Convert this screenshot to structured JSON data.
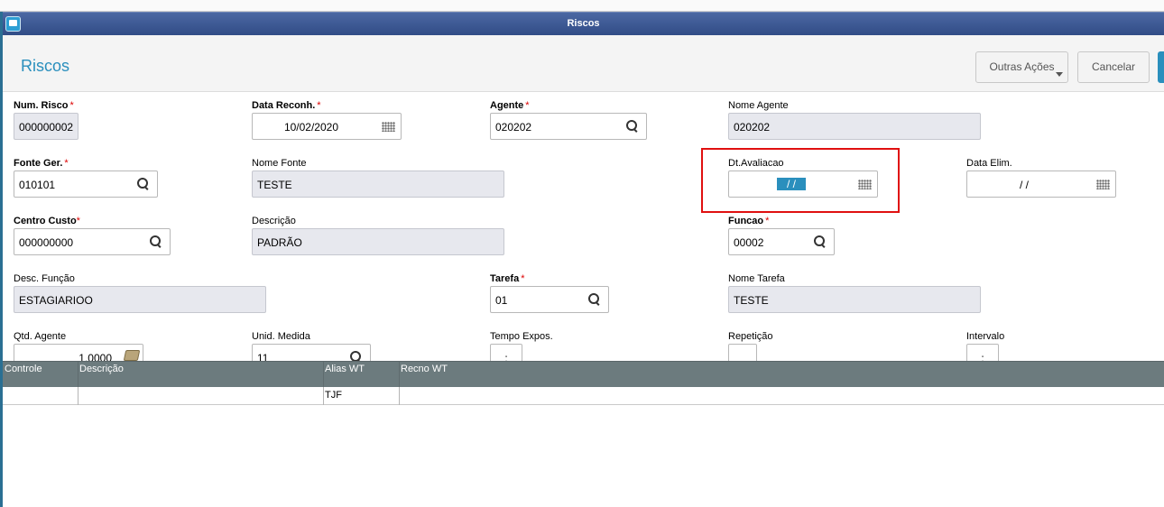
{
  "window": {
    "title": "Riscos"
  },
  "header": {
    "page_title": "Riscos",
    "buttons": {
      "other_actions": "Outras Ações",
      "cancel": "Cancelar"
    }
  },
  "fields": {
    "num_risco": {
      "label": "Num. Risco",
      "required": "*",
      "value": "000000002"
    },
    "data_reconh": {
      "label": "Data Reconh.",
      "required": "*",
      "value": "10/02/2020"
    },
    "agente": {
      "label": "Agente",
      "required": "*",
      "value": "020202"
    },
    "nome_agente": {
      "label": "Nome Agente",
      "value": "020202"
    },
    "fonte_ger": {
      "label": "Fonte Ger.",
      "required": "*",
      "value": "010101"
    },
    "nome_fonte": {
      "label": "Nome Fonte",
      "value": "TESTE"
    },
    "dt_avaliacao": {
      "label": "Dt.Avaliacao",
      "value": "/ /"
    },
    "data_elim": {
      "label": "Data Elim.",
      "value": "/ /"
    },
    "centro_custo": {
      "label": "Centro Custo",
      "required": "*",
      "value": "000000000"
    },
    "descricao": {
      "label": "Descrição",
      "value": "PADRÃO"
    },
    "funcao": {
      "label": "Funcao",
      "required": "*",
      "value": "00002"
    },
    "desc_funcao": {
      "label": "Desc. Função",
      "value": "ESTAGIARIOO"
    },
    "tarefa": {
      "label": "Tarefa",
      "required": "*",
      "value": "01"
    },
    "nome_tarefa": {
      "label": "Nome Tarefa",
      "value": "TESTE"
    },
    "qtd_agente": {
      "label": "Qtd. Agente",
      "value": "1,0000"
    },
    "unid_medida": {
      "label": "Unid. Medida",
      "value": "11"
    },
    "tempo_expos": {
      "label": "Tempo Expos.",
      "value": ":"
    },
    "repeticao": {
      "label": "Repetição",
      "value": ""
    },
    "intervalo": {
      "label": "Intervalo",
      "value": ":"
    }
  },
  "grid": {
    "columns": [
      "Controle",
      "Descrição",
      "Alias WT",
      "Recno WT"
    ],
    "rows": [
      {
        "controle": "",
        "descricao": "",
        "alias_wt": "TJF",
        "recno_wt": ""
      }
    ]
  },
  "colors": {
    "title_bar": "#3b5794",
    "accent": "#2a8fbd",
    "highlight_box": "#e01010",
    "grid_header": "#6c7b7e"
  },
  "icons": {
    "lookup": "magnifier-icon",
    "date": "calendar-grid-icon",
    "number": "money-icon"
  }
}
